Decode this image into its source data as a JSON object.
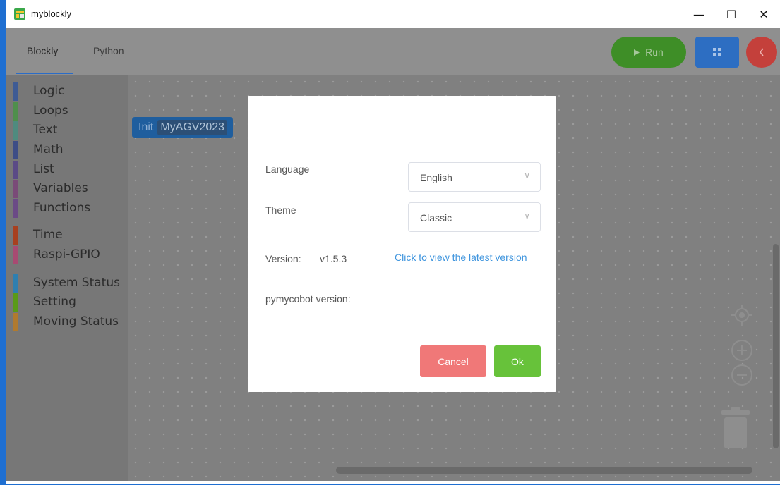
{
  "window": {
    "title": "myblockly",
    "minimize_glyph": "—",
    "maximize_glyph": "☐",
    "close_glyph": "✕"
  },
  "header": {
    "tabs": [
      {
        "label": "Blockly",
        "active": true
      },
      {
        "label": "Python",
        "active": false
      }
    ],
    "run_label": "Run",
    "colors": {
      "run": "#3e8e27",
      "grid": "#2d6ec2",
      "back": "#c4403b"
    }
  },
  "sidebar": {
    "categories": [
      {
        "label": "Logic",
        "color": "#3e5b94"
      },
      {
        "label": "Loops",
        "color": "#4f8f4c"
      },
      {
        "label": "Text",
        "color": "#4f8b7f"
      },
      {
        "label": "Math",
        "color": "#3e4d86"
      },
      {
        "label": "List",
        "color": "#5a4a86"
      },
      {
        "label": "Variables",
        "color": "#7a4a78"
      },
      {
        "label": "Functions",
        "color": "#6b4a86"
      },
      {
        "label": "Time",
        "color": "#a8401f"
      },
      {
        "label": "Raspi-GPIO",
        "color": "#a84a72"
      },
      {
        "label": "System Status",
        "color": "#2e7fb0"
      },
      {
        "label": "Setting",
        "color": "#5a9a18"
      },
      {
        "label": "Moving Status",
        "color": "#b07a2e"
      }
    ]
  },
  "workspace": {
    "block": {
      "label": "Init",
      "field_value": "MyAGV2023"
    }
  },
  "dialog": {
    "language_label": "Language",
    "language_value": "English",
    "theme_label": "Theme",
    "theme_value": "Classic",
    "version_label": "Version:",
    "version_value": "v1.5.3",
    "latest_link": "Click to view the latest version",
    "pymycobot_label": "pymycobot version:",
    "cancel_label": "Cancel",
    "ok_label": "Ok"
  }
}
